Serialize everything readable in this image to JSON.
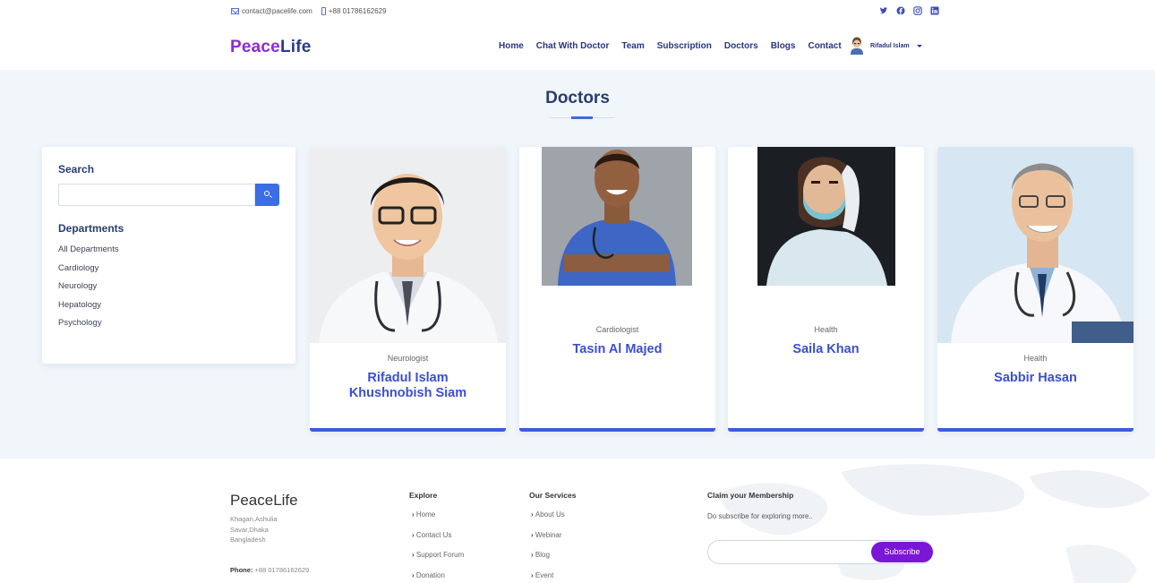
{
  "topbar": {
    "email": "contact@pacelife.com",
    "phone": "+88 01786162629",
    "social": [
      "twitter-icon",
      "facebook-icon",
      "instagram-icon",
      "linkedin-icon"
    ]
  },
  "nav": {
    "logo_part1": "Peace",
    "logo_part2": "Life",
    "menu": [
      "Home",
      "Chat With Doctor",
      "Team",
      "Subscription",
      "Doctors",
      "Blogs",
      "Contact"
    ],
    "user_name": "Rifadul Islam"
  },
  "page": {
    "title": "Doctors"
  },
  "sidebar": {
    "search_title": "Search",
    "search_value": "",
    "departments_title": "Departments",
    "departments": [
      "All Departments",
      "Cardiology",
      "Neurology",
      "Hepatology",
      "Psychology"
    ]
  },
  "doctors": [
    {
      "specialty": "Neurologist",
      "name": "Rifadul Islam Khushnobish Siam"
    },
    {
      "specialty": "Cardiologist",
      "name": "Tasin Al Majed"
    },
    {
      "specialty": "Health",
      "name": "Saila Khan"
    },
    {
      "specialty": "Health",
      "name": "Sabbir Hasan"
    }
  ],
  "footer": {
    "brand": "PeaceLife",
    "address": [
      "Khagan,Ashulia",
      "Savar,Dhaka",
      "Bangladesh"
    ],
    "phone_label": "Phone:",
    "phone_value": "+88 01786162629",
    "explore_title": "Explore",
    "explore_links": [
      "Home",
      "Contact Us",
      "Support Forum",
      "Donation"
    ],
    "services_title": "Our Services",
    "services_links": [
      "About Us",
      "Webinar",
      "Blog",
      "Event"
    ],
    "membership_title": "Claim your Membership",
    "membership_text": "Do subscribe for exploring more..",
    "subscribe_label": "Subscribe",
    "subscribe_value": ""
  },
  "colors": {
    "accent": "#3b5be0",
    "brand_purple": "#8e2ad8",
    "nav_text": "#283583",
    "subscribe_button": "#7a16d6"
  }
}
